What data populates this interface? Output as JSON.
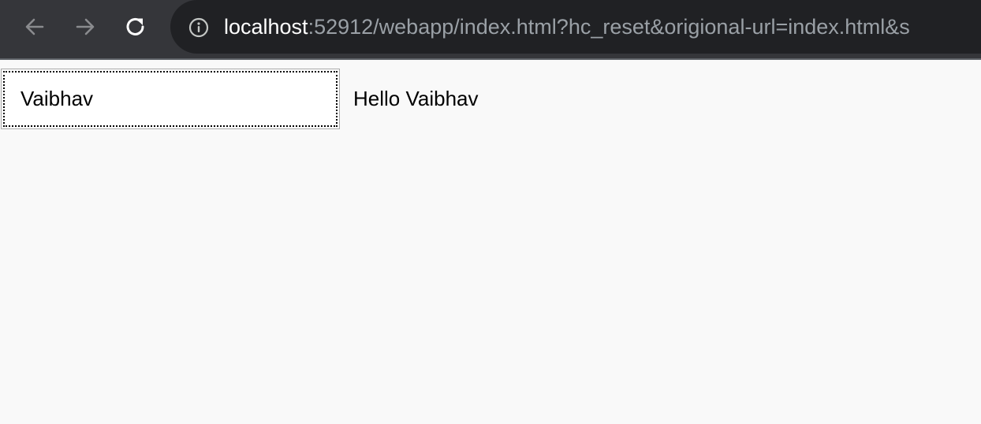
{
  "browser": {
    "url_host": "localhost",
    "url_rest": ":52912/webapp/index.html?hc_reset&origional-url=index.html&s",
    "icons": {
      "back": "arrow-left-icon",
      "forward": "arrow-right-icon",
      "reload": "reload-icon",
      "site_info": "info-circle-icon"
    }
  },
  "page": {
    "name_input_value": "Vaibhav",
    "greeting_text": "Hello Vaibhav"
  },
  "colors": {
    "toolbar": "#35363a",
    "omnibox": "#202124",
    "page_bg": "#f9f9f9"
  }
}
